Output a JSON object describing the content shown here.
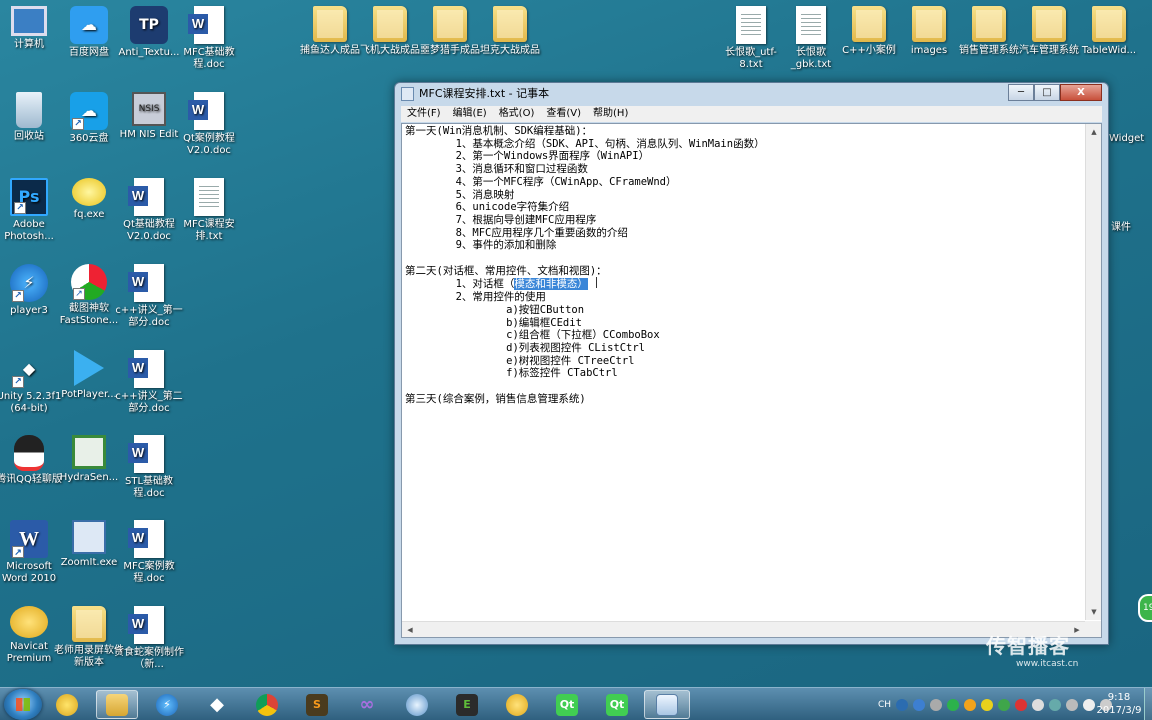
{
  "desktop": {
    "col1": [
      "计算机",
      "回收站",
      "Adobe Photosh...",
      "player3",
      "Unity 5.2.3f1 (64-bit)",
      "腾讯QQ轻聊版",
      "Microsoft Word 2010",
      "Navicat Premium"
    ],
    "col2": [
      "百度网盘",
      "360云盘",
      "fq.exe",
      "截图神软 FastStone...",
      "PotPlayer...",
      "HydraSen...",
      "ZoomIt.exe",
      "老师用录屏软件新版本"
    ],
    "col3": [
      "Anti_Textu...",
      "HM NIS Edit",
      "Qt基础教程V2.0.doc",
      "c++讲义_第一部分.doc",
      "c++讲义_第二部分.doc",
      "STL基础教程.doc",
      "MFC案例教程.doc",
      "贪食蛇案例制作（新..."
    ],
    "col4": [
      "MFC基础教程.doc",
      "Qt案例教程V2.0.doc",
      "MFC课程安排.txt"
    ],
    "top": [
      "捕鱼达人成品",
      "飞机大战成品",
      "噩梦猎手成品",
      "坦克大战成品",
      "长恨歌_utf-8.txt",
      "长恨歌_gbk.txt",
      "C++小案例",
      "images",
      "销售管理系统",
      "汽车管理系统",
      "TableWid..."
    ],
    "right_partial": [
      "Widget",
      "课件"
    ]
  },
  "notepad": {
    "title": "MFC课程安排.txt - 记事本",
    "menu": [
      "文件(F)",
      "编辑(E)",
      "格式(O)",
      "查看(V)",
      "帮助(H)"
    ],
    "controls": {
      "min": "─",
      "max": "□",
      "close": "X"
    },
    "lines_before_highlight": "第一天(Win消息机制、SDK编程基础)：\n        1、基本概念介绍（SDK、API、句柄、消息队列、WinMain函数）\n        2、第一个Windows界面程序（WinAPI）\n        3、消息循环和窗口过程函数\n        4、第一个MFC程序（CWinApp、CFrameWnd）\n        5、消息映射\n        6、unicode字符集介绍\n        7、根据向导创建MFC应用程序\n        8、MFC应用程序几个重要函数的介绍\n        9、事件的添加和删除\n\n第二天(对话框、常用控件、文档和视图)：\n        1、对话框（",
    "highlight": "模态和非模态）",
    "lines_after_highlight": "\n        2、常用控件的使用\n                a)按钮CButton\n                b)编辑框CEdit\n                c)组合框（下拉框）CComboBox\n                d)列表视图控件 CListCtrl\n                e)树视图控件 CTreeCtrl\n                f)标签控件 CTabCtrl\n\n第三天(综合案例，销售信息管理系统)"
  },
  "taskbar": {
    "tray_lang": "CH",
    "time": "9:18",
    "date": "2017/3/9"
  },
  "watermark": {
    "brand": "传智播客",
    "url": "www.itcast.cn"
  },
  "edge_badge": "19"
}
